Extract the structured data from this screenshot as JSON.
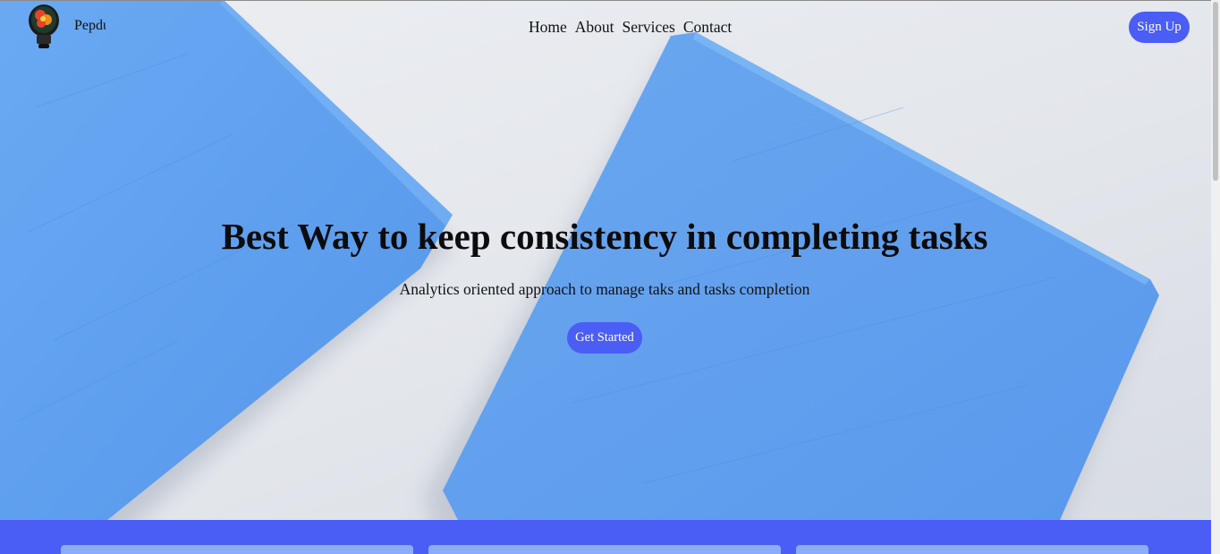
{
  "navbar": {
    "brand": "Pepdu",
    "links": [
      "Home",
      "About",
      "Services",
      "Contact"
    ],
    "signup_label": "Sign Up"
  },
  "hero": {
    "title": "Best Way to keep consistency in completing tasks",
    "subtitle": "Analytics oriented approach to manage taks and tasks completion",
    "cta_label": "Get Started"
  },
  "colors": {
    "accent": "#4a5df5",
    "card": "#8aaef5",
    "block_blue": "#5e9ff0"
  },
  "icons": {
    "logo": "lightbulb-logo-icon"
  }
}
